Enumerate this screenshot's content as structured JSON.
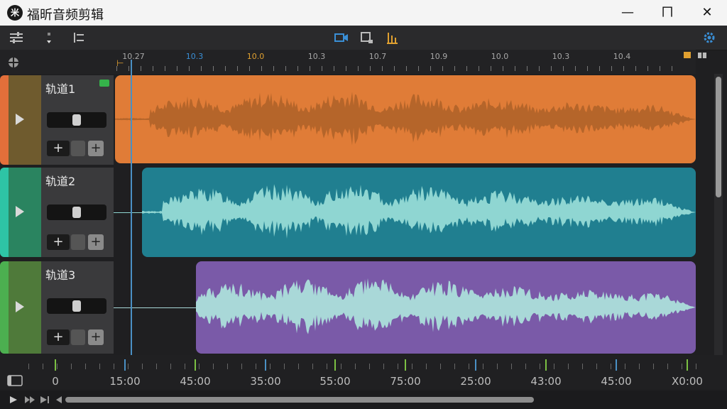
{
  "app": {
    "title": "福昕音频剪辑",
    "logo_glyph": "米"
  },
  "window_controls": {
    "minimize": "—",
    "maximize": "ㄇ",
    "close": "✕"
  },
  "toolbar": {
    "left_icons": [
      "settings-icon",
      "marker-icon",
      "swap-icon"
    ],
    "center_icons": [
      "camera-icon",
      "crop-icon",
      "bars-icon"
    ],
    "right_icons": [
      "gear-icon"
    ],
    "accent": "#3a8fd6",
    "highlight": "#e0a030"
  },
  "ruler": {
    "labels": [
      "10.27",
      "10.3",
      "10.0",
      "10.3",
      "10.7",
      "10.9",
      "10.0",
      "10.3",
      "10.4"
    ],
    "highlight_index_blue": 1,
    "highlight_index_yellow": 2
  },
  "tracks": [
    {
      "name": "轨道1",
      "color": "#e07c37",
      "stripe": "#e36f3a",
      "side": "#6f5b2e",
      "wave": "#b5652a"
    },
    {
      "name": "轨道2",
      "color": "#207f90",
      "stripe": "#2ec4a5",
      "side": "#2a8460",
      "wave": "#8fd6d2"
    },
    {
      "name": "轨道3",
      "color": "#7a5aa8",
      "stripe": "#4caf50",
      "side": "#4f7a3a",
      "wave": "#a9d8d8"
    }
  ],
  "timeline": {
    "labels": [
      "0",
      "15:00",
      "45:00",
      "35:00",
      "55:00",
      "75:00",
      "25:00",
      "43:00",
      "45:00",
      "X0:00"
    ]
  },
  "transport": {
    "buttons": [
      "play-icon",
      "skip-back-icon",
      "skip-forward-icon",
      "rewind-icon"
    ]
  }
}
